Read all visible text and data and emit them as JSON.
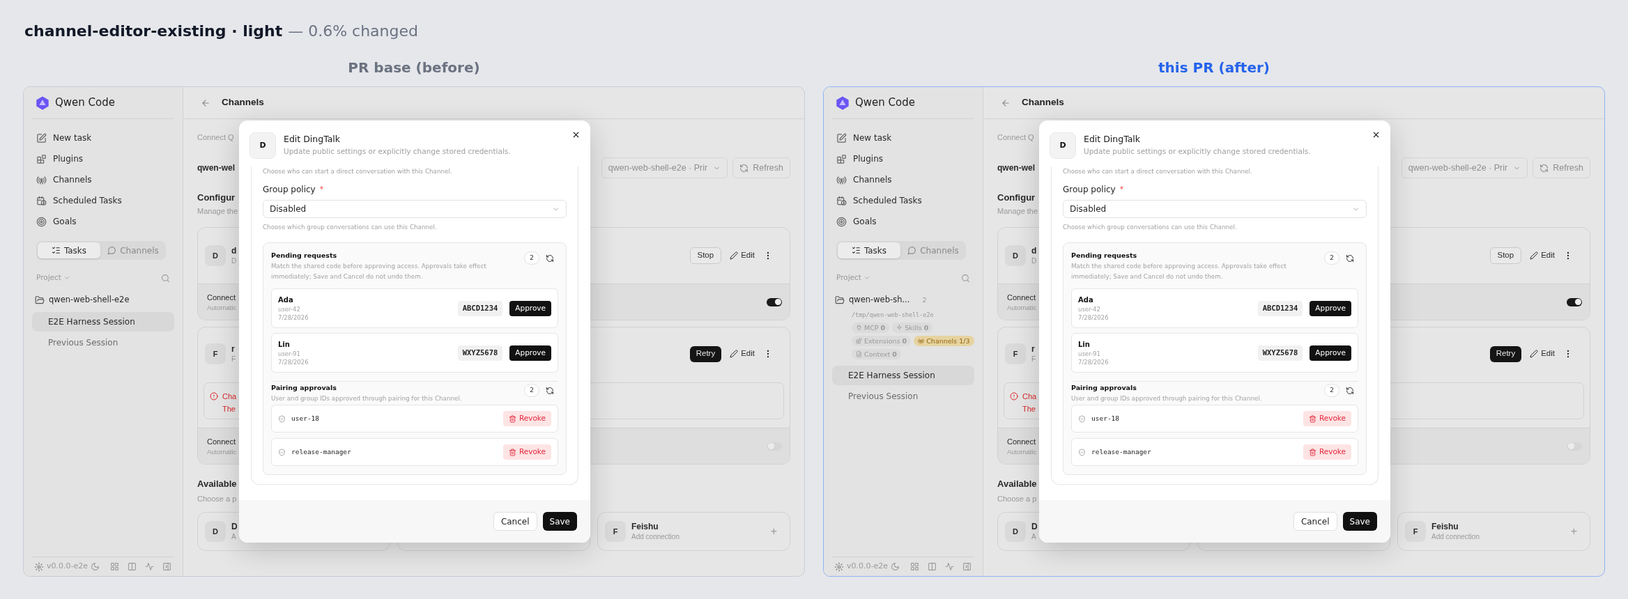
{
  "title": {
    "name": "channel-editor-existing · light",
    "note": "— 0.6% changed"
  },
  "panels": [
    {
      "kind": "before",
      "label": "PR base (before)",
      "sidebar": {
        "brand": "Qwen Code",
        "nav": [
          {
            "label": "New task"
          },
          {
            "label": "Plugins"
          },
          {
            "label": "Channels"
          },
          {
            "label": "Scheduled Tasks"
          },
          {
            "label": "Goals"
          }
        ],
        "tabs": [
          {
            "label": "Tasks",
            "selected": true
          },
          {
            "label": "Channels",
            "selected": false
          }
        ],
        "project_filter": "Project",
        "project": {
          "name": "qwen-web-shell-e2e"
        },
        "sessions": [
          {
            "label": "E2E Harness Session",
            "selected": true
          },
          {
            "label": "Previous Session",
            "selected": false
          }
        ],
        "version": "v0.0.0-e2e"
      },
      "main": {
        "title": "Channels",
        "intro": "Connect Q",
        "workspace": "qwen-wel",
        "workspace_select": "qwen-web-shell-e2e · Prir",
        "refresh": "Refresh",
        "configured_title": "Configur",
        "configured_description": "Manage the",
        "configured": [
          {
            "avatar": "D",
            "title": "d",
            "subtitle": "D",
            "actions": [
              {
                "label": "Stop",
                "kind": "outline"
              },
              {
                "label": "Edit",
                "kind": "edit"
              }
            ],
            "footer_title": "Connect",
            "footer_subtitle": "Automatic",
            "enabled": true
          },
          {
            "avatar": "F",
            "title": "r",
            "subtitle": "F",
            "actions": [
              {
                "label": "Retry",
                "kind": "primary"
              },
              {
                "label": "Edit",
                "kind": "edit"
              }
            ],
            "error": {
              "title": "Cha",
              "message": "The"
            },
            "footer_title": "Connect",
            "footer_subtitle": "Automatic",
            "enabled": false
          }
        ],
        "available_title": "Available",
        "available_description": "Choose a p",
        "available": [
          {
            "avatar": "D",
            "title": "D",
            "subtitle": "A"
          },
          {
            "covered": true
          },
          {
            "avatar": "F",
            "title": "Feishu",
            "subtitle": "Add connection",
            "add": "+"
          }
        ]
      },
      "dialog": {
        "avatar": "D",
        "title": "Edit DingTalk",
        "subtitle": "Update public settings or explicitly change stored credentials.",
        "dm_policy_help": "Choose who can start a direct conversation with this Channel.",
        "group_policy": {
          "label": "Group policy",
          "required": "*",
          "value": "Disabled",
          "help": "Choose which group conversations can use this Channel."
        },
        "pending": {
          "title": "Pending requests",
          "description": "Match the shared code before approving access. Approvals take effect immediately; Save and Cancel do not undo them.",
          "count": "2",
          "requests": [
            {
              "name": "Ada",
              "user": "user-42",
              "date": "7/28/2026",
              "code": "ABCD1234",
              "action": "Approve"
            },
            {
              "name": "Lin",
              "user": "user-91",
              "date": "7/28/2026",
              "code": "WXYZ5678",
              "action": "Approve"
            }
          ]
        },
        "pairing": {
          "title": "Pairing approvals",
          "description": "User and group IDs approved through pairing for this Channel.",
          "count": "2",
          "approvals": [
            {
              "id": "user-18",
              "action": "Revoke"
            },
            {
              "id": "release-manager",
              "action": "Revoke"
            }
          ]
        },
        "buttons": [
          {
            "label": "Cancel",
            "kind": "secondary"
          },
          {
            "label": "Save",
            "kind": "primary"
          }
        ]
      }
    },
    {
      "kind": "after",
      "label": "this PR (after)",
      "sidebar": {
        "brand": "Qwen Code",
        "nav": [
          {
            "label": "New task"
          },
          {
            "label": "Plugins"
          },
          {
            "label": "Channels"
          },
          {
            "label": "Scheduled Tasks"
          },
          {
            "label": "Goals"
          }
        ],
        "tabs": [
          {
            "label": "Tasks",
            "selected": true
          },
          {
            "label": "Channels",
            "selected": false
          }
        ],
        "project_filter": "Project",
        "project": {
          "name": "qwen-web-sh...",
          "count": "2",
          "path": "/tmp/qwen-web-shell-e2e",
          "chips": [
            {
              "label": "MCP **0**",
              "highlighted": false
            },
            {
              "label": "Skills **0**",
              "highlighted": false
            },
            {
              "label": "Extensions **0**",
              "highlighted": false
            },
            {
              "label": "Channels 1/3",
              "highlighted": true
            },
            {
              "label": "Context **0**",
              "highlighted": false
            }
          ]
        },
        "sessions": [
          {
            "label": "E2E Harness Session",
            "selected": true
          },
          {
            "label": "Previous Session",
            "selected": false
          }
        ],
        "version": "v0.0.0-e2e"
      },
      "main": {
        "title": "Channels",
        "intro": "Connect Q",
        "workspace": "qwen-wel",
        "workspace_select": "qwen-web-shell-e2e · Prir",
        "refresh": "Refresh",
        "configured_title": "Configur",
        "configured_description": "Manage the",
        "configured": [
          {
            "avatar": "D",
            "title": "d",
            "subtitle": "D",
            "actions": [
              {
                "label": "Stop",
                "kind": "outline"
              },
              {
                "label": "Edit",
                "kind": "edit"
              }
            ],
            "footer_title": "Connect",
            "footer_subtitle": "Automatic",
            "enabled": true
          },
          {
            "avatar": "F",
            "title": "r",
            "subtitle": "F",
            "actions": [
              {
                "label": "Retry",
                "kind": "primary"
              },
              {
                "label": "Edit",
                "kind": "edit"
              }
            ],
            "error": {
              "title": "Cha",
              "message": "The"
            },
            "footer_title": "Connect",
            "footer_subtitle": "Automatic",
            "enabled": false
          }
        ],
        "available_title": "Available",
        "available_description": "Choose a p",
        "available": [
          {
            "avatar": "D",
            "title": "D",
            "subtitle": "A"
          },
          {
            "covered": true
          },
          {
            "avatar": "F",
            "title": "Feishu",
            "subtitle": "Add connection",
            "add": "+"
          }
        ]
      },
      "dialog": {
        "avatar": "D",
        "title": "Edit DingTalk",
        "subtitle": "Update public settings or explicitly change stored credentials.",
        "dm_policy_help": "Choose who can start a direct conversation with this Channel.",
        "group_policy": {
          "label": "Group policy",
          "required": "*",
          "value": "Disabled",
          "help": "Choose which group conversations can use this Channel."
        },
        "pending": {
          "title": "Pending requests",
          "description": "Match the shared code before approving access. Approvals take effect immediately; Save and Cancel do not undo them.",
          "count": "2",
          "requests": [
            {
              "name": "Ada",
              "user": "user-42",
              "date": "7/28/2026",
              "code": "ABCD1234",
              "action": "Approve"
            },
            {
              "name": "Lin",
              "user": "user-91",
              "date": "7/28/2026",
              "code": "WXYZ5678",
              "action": "Approve"
            }
          ]
        },
        "pairing": {
          "title": "Pairing approvals",
          "description": "User and group IDs approved through pairing for this Channel.",
          "count": "2",
          "approvals": [
            {
              "id": "user-18",
              "action": "Revoke"
            },
            {
              "id": "release-manager",
              "action": "Revoke"
            }
          ]
        },
        "buttons": [
          {
            "label": "Cancel",
            "kind": "secondary"
          },
          {
            "label": "Save",
            "kind": "primary"
          }
        ]
      }
    }
  ]
}
